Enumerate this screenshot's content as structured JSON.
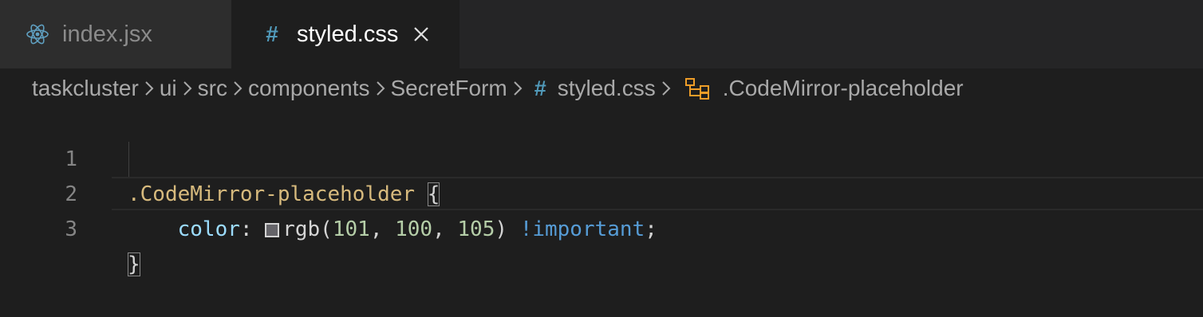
{
  "tabs": [
    {
      "label": "index.jsx",
      "icon": "react-icon",
      "active": false
    },
    {
      "label": "styled.css",
      "icon": "hash-icon",
      "active": true,
      "close": "close-icon"
    }
  ],
  "breadcrumb": {
    "items": [
      "taskcluster",
      "ui",
      "src",
      "components",
      "SecretForm"
    ],
    "file": "styled.css",
    "file_icon": "#",
    "symbol": ".CodeMirror-placeholder",
    "symbol_icon": "symbol-structure-icon"
  },
  "editor": {
    "lines": [
      {
        "number": "1",
        "selector": ".CodeMirror-placeholder",
        "brace": "{"
      },
      {
        "number": "2",
        "indent": "    ",
        "property": "color",
        "colon": ":",
        "swatch_color": "#656469",
        "fn_open": "rgb(",
        "n1": "101",
        "comma1": ", ",
        "n2": "100",
        "comma2": ", ",
        "n3": "105",
        "fn_close": ")",
        "important": "!important",
        "semicolon": ";"
      },
      {
        "number": "3",
        "brace": "}"
      }
    ]
  },
  "colors": {
    "accent_hash": "#519aba",
    "react": "#61dafb",
    "symbol": "#ee9d28"
  }
}
